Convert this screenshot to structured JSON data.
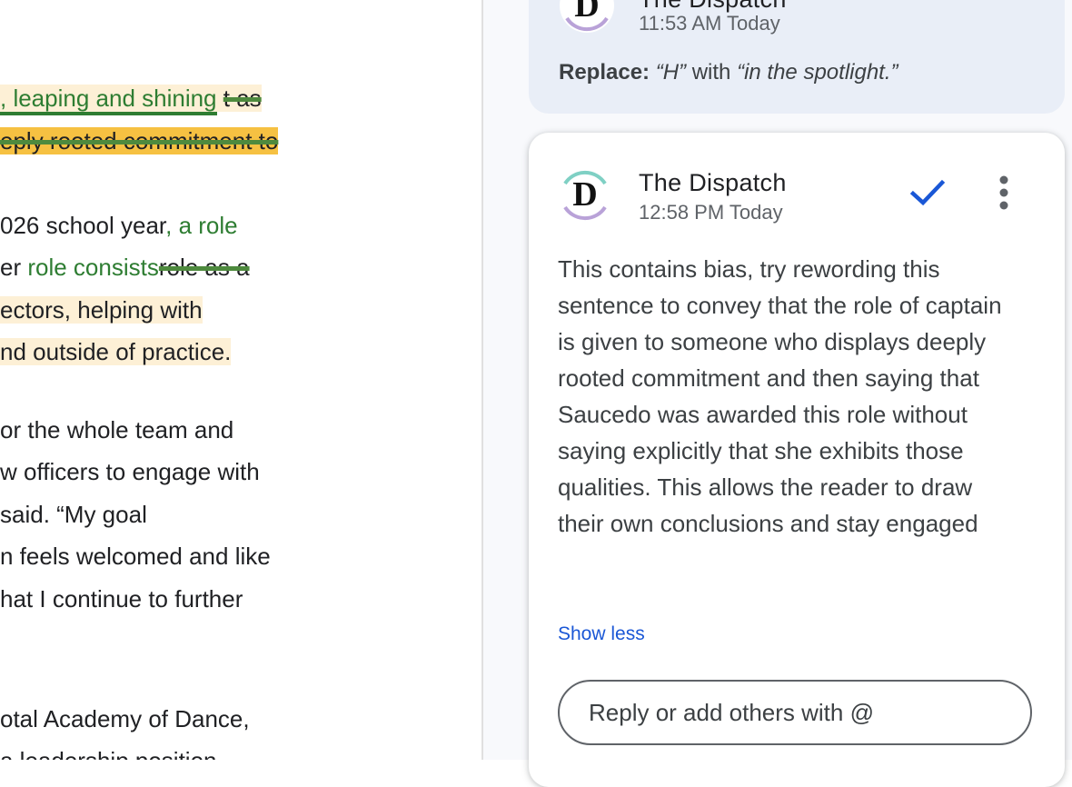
{
  "document": {
    "lines": [
      {
        "segments": [
          {
            "text": ", leaping and shining",
            "style": "ins hl-light ins-under"
          },
          {
            "text": " ",
            "style": "hl-light"
          },
          {
            "text": "t as",
            "style": "del hl-light"
          }
        ]
      },
      {
        "segments": [
          {
            "text": "eply rooted commitment to",
            "style": "del hl-strong"
          }
        ]
      },
      {
        "segments": [
          {
            "text": "026 school year",
            "style": ""
          },
          {
            "text": ", a role",
            "style": "ins"
          }
        ]
      },
      {
        "segments": [
          {
            "text": "er ",
            "style": ""
          },
          {
            "text": "role consists",
            "style": "ins"
          },
          {
            "text": "role as a",
            "style": "del ins"
          }
        ]
      },
      {
        "segments": [
          {
            "text": "ectors, helping with ",
            "style": "hl-light"
          }
        ]
      },
      {
        "segments": [
          {
            "text": "nd outside of practice. ",
            "style": "hl-light"
          }
        ]
      },
      {
        "segments": [
          {
            "text": "or the whole team and",
            "style": ""
          }
        ]
      },
      {
        "segments": [
          {
            "text": "w officers to engage with",
            "style": ""
          }
        ]
      },
      {
        "segments": [
          {
            "text": "said. “My goal",
            "style": ""
          }
        ]
      },
      {
        "segments": [
          {
            "text": "n feels welcomed and like",
            "style": ""
          }
        ]
      },
      {
        "segments": [
          {
            "text": "hat I continue to further",
            "style": ""
          }
        ]
      },
      {
        "segments": [
          {
            "text": "otal Academy of Dance,",
            "style": ""
          }
        ]
      },
      {
        "segments": [
          {
            "text": "a leadership position",
            "style": ""
          }
        ]
      }
    ]
  },
  "previous_comment": {
    "author": "The Dispatch",
    "time": "11:53 AM Today",
    "replace_label": "Replace:",
    "from_text": "“H”",
    "with_word": "with",
    "to_text": "“in the spotlight.”"
  },
  "comment": {
    "author": "The Dispatch",
    "time": "12:58 PM Today",
    "body": "This contains bias, try rewording this sentence to convey that the role of captain is given to someone who displays deeply rooted commitment and then saying that Saucedo was awarded this role without saying explicitly that she exhibits those qualities. This allows the reader to draw their own conclusions and stay engaged",
    "show_less": "Show less",
    "reply_placeholder": "Reply or add others with @",
    "icons": {
      "resolve": "check-icon",
      "more": "more-vert-icon"
    },
    "colors": {
      "accent": "#1a57d6",
      "insert": "#2e7d32"
    }
  }
}
